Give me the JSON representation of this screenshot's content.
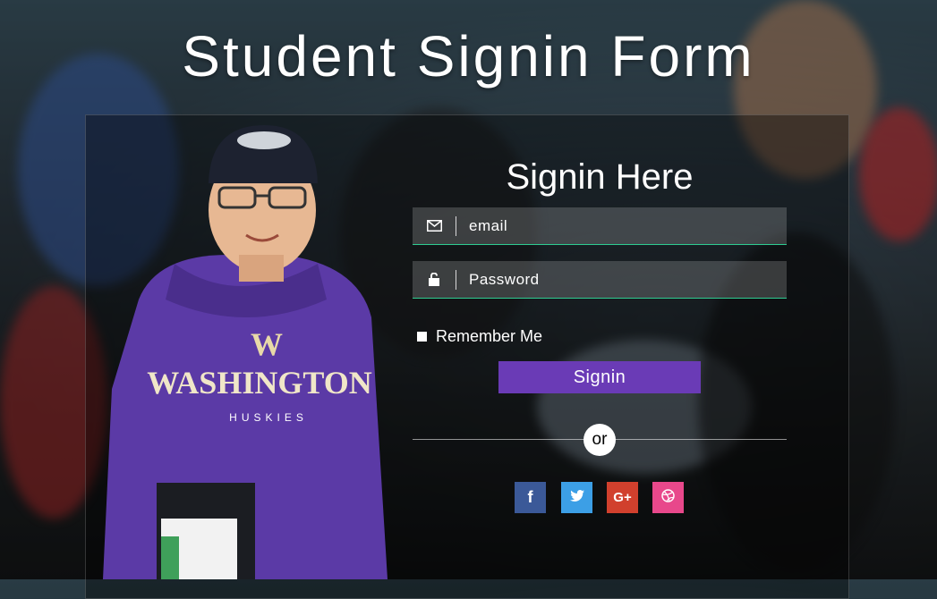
{
  "page": {
    "title": "Student Signin Form"
  },
  "form": {
    "heading": "Signin Here",
    "email": {
      "placeholder": "email",
      "icon": "envelope-icon"
    },
    "password": {
      "placeholder": "Password",
      "icon": "unlock-icon"
    },
    "remember_label": "Remember Me",
    "signin_label": "Signin",
    "or_label": "or",
    "accent_color": "#6a3bb6",
    "underline_color": "#2ecc91"
  },
  "social": [
    {
      "name": "facebook",
      "glyph": "f",
      "color": "#3b5998",
      "icon": "facebook-icon"
    },
    {
      "name": "twitter",
      "glyph": "t",
      "color": "#3c9fe6",
      "icon": "twitter-icon"
    },
    {
      "name": "google-plus",
      "glyph": "G+",
      "color": "#d1402d",
      "icon": "google-plus-icon"
    },
    {
      "name": "dribbble",
      "glyph": "◎",
      "color": "#e8488b",
      "icon": "dribbble-icon"
    }
  ]
}
